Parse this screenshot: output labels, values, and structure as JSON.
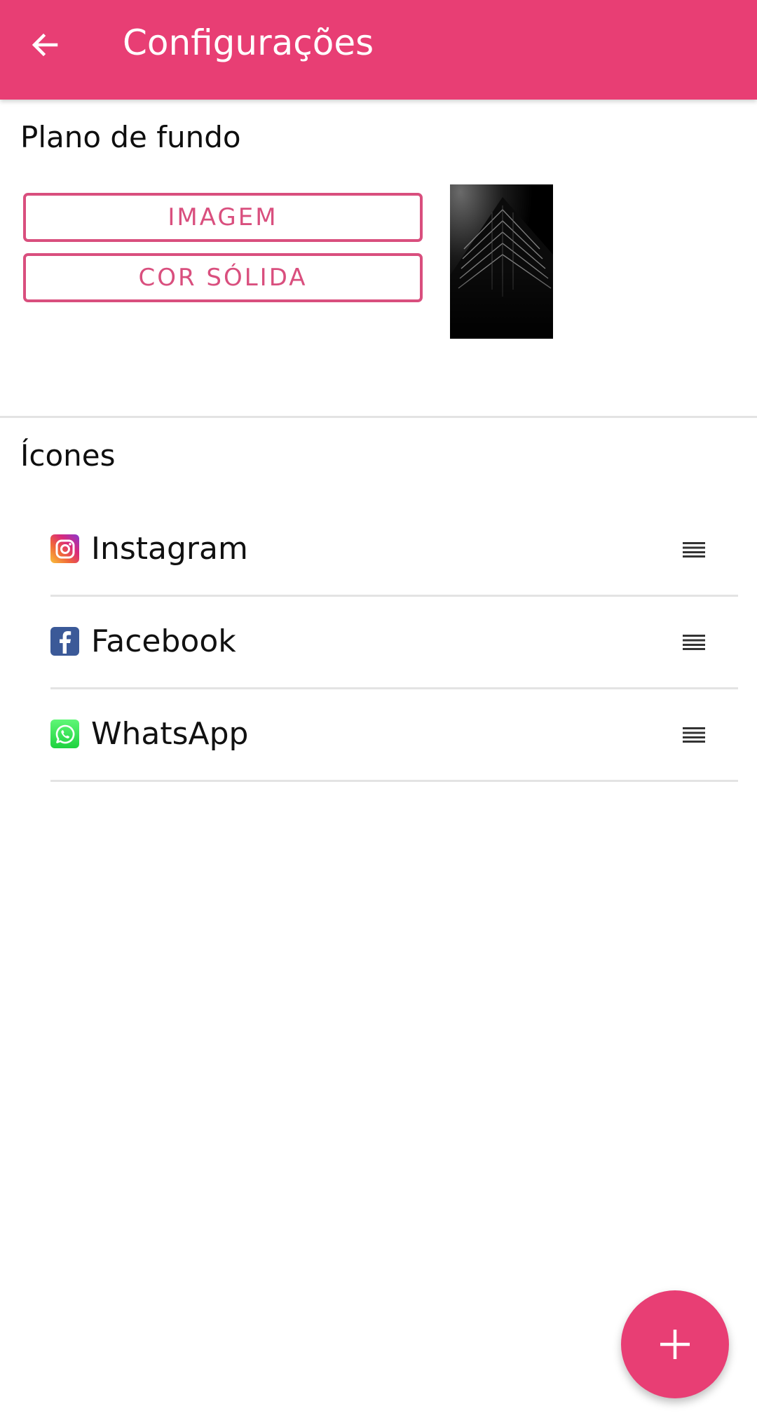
{
  "app_bar": {
    "title": "Configurações",
    "back_icon": "arrow-left-icon",
    "color": "#e83e74"
  },
  "background_section": {
    "title": "Plano de fundo",
    "image_button": "IMAGEM",
    "solid_color_button": "COR SÓLIDA",
    "accent_color": "#d94f7e"
  },
  "icons_section": {
    "title": "Ícones",
    "items": [
      {
        "label": "Instagram",
        "icon": "instagram-icon"
      },
      {
        "label": "Facebook",
        "icon": "facebook-icon"
      },
      {
        "label": "WhatsApp",
        "icon": "whatsapp-icon"
      }
    ],
    "drag_icon": "drag-handle-icon"
  },
  "fab": {
    "icon": "plus-icon",
    "color": "#e83e74"
  }
}
